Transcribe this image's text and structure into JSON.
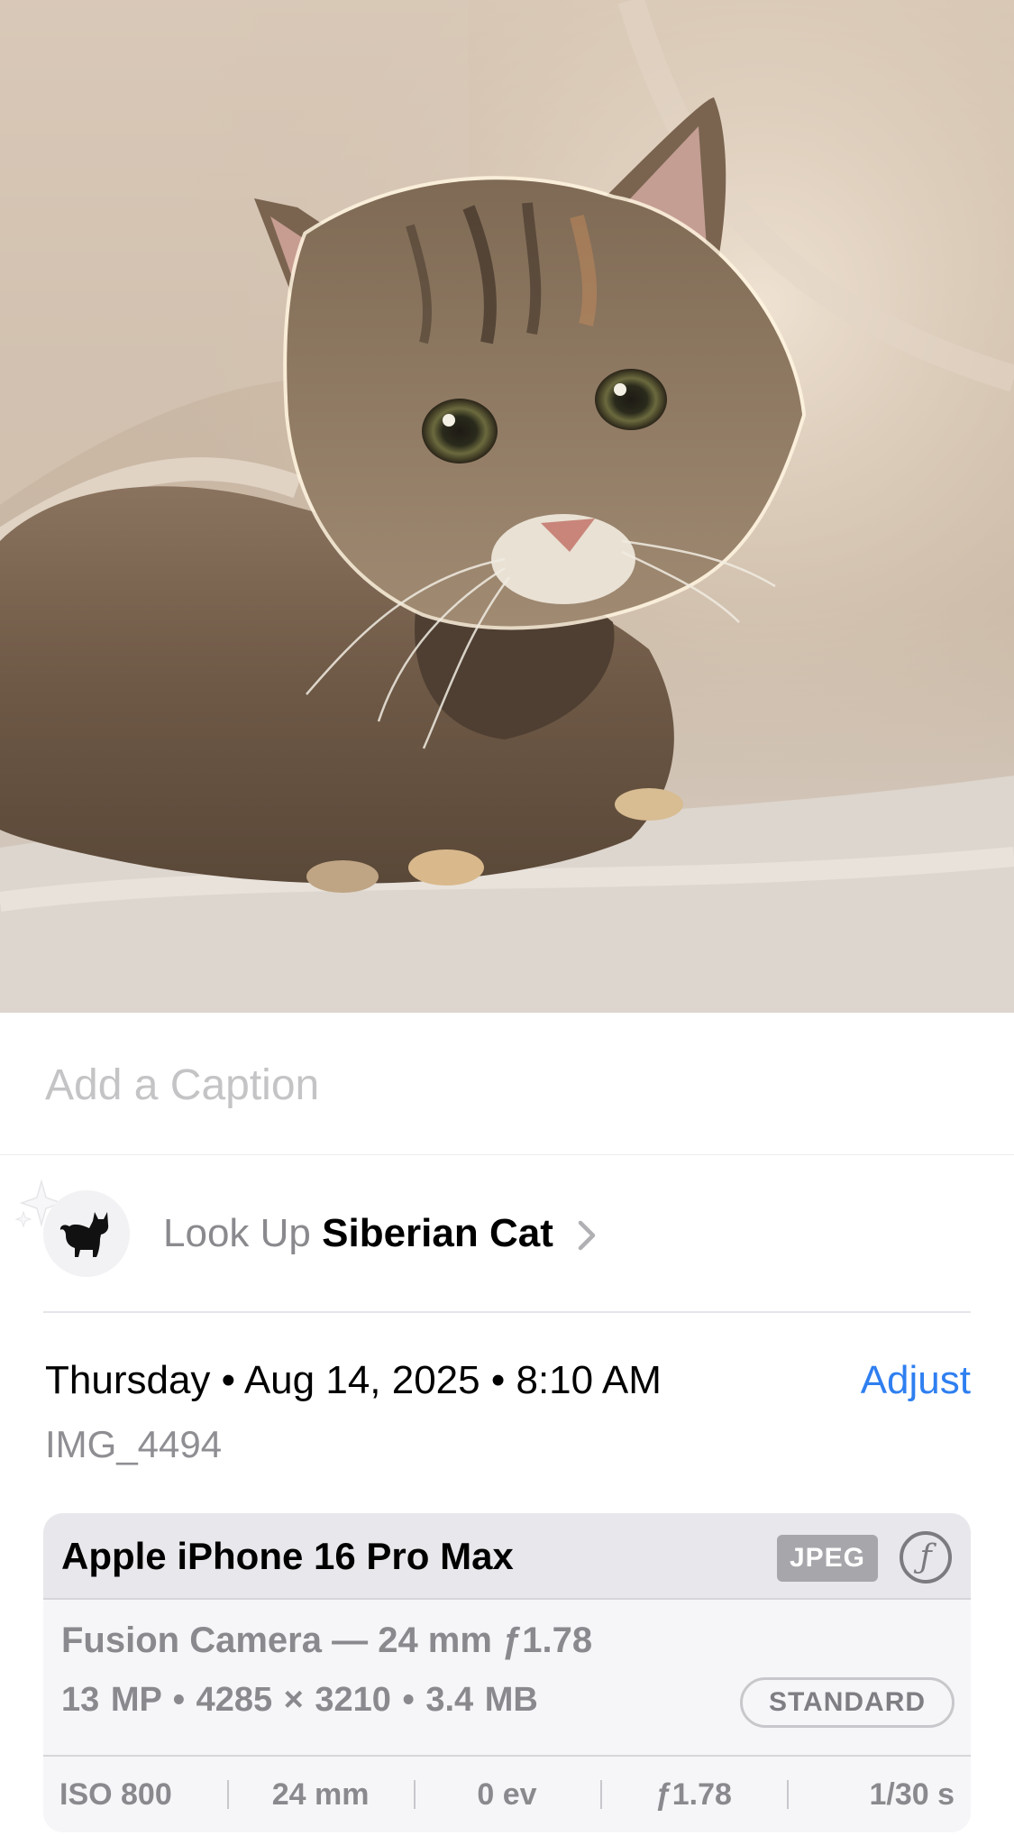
{
  "photo": {
    "subject_icon": "cat-photo"
  },
  "caption": {
    "placeholder": "Add a Caption"
  },
  "lookup": {
    "icon": "cat-icon",
    "sparkle_icon": "sparkle-icon",
    "prefix": "Look Up",
    "subject": "Siberian Cat",
    "chevron_icon": "chevron-right-icon"
  },
  "date": {
    "text": "Thursday • Aug 14, 2025 • 8:10 AM",
    "adjust_label": "Adjust"
  },
  "filename": "IMG_4494",
  "exif": {
    "device": "Apple iPhone 16 Pro Max",
    "format_badge": "JPEG",
    "aperture_icon": "f-stop-icon",
    "lens": "Fusion Camera — 24 mm ƒ1.78",
    "specs": "13 MP  •  4285 × 3210  •  3.4 MB",
    "style_badge": "STANDARD",
    "stats": [
      "ISO 800",
      "24 mm",
      "0 ev",
      "ƒ1.78",
      "1/30 s"
    ]
  },
  "colors": {
    "accent": "#2f7ff0",
    "secondary_text": "#8a8a8e",
    "placeholder": "#c4c4c6"
  }
}
